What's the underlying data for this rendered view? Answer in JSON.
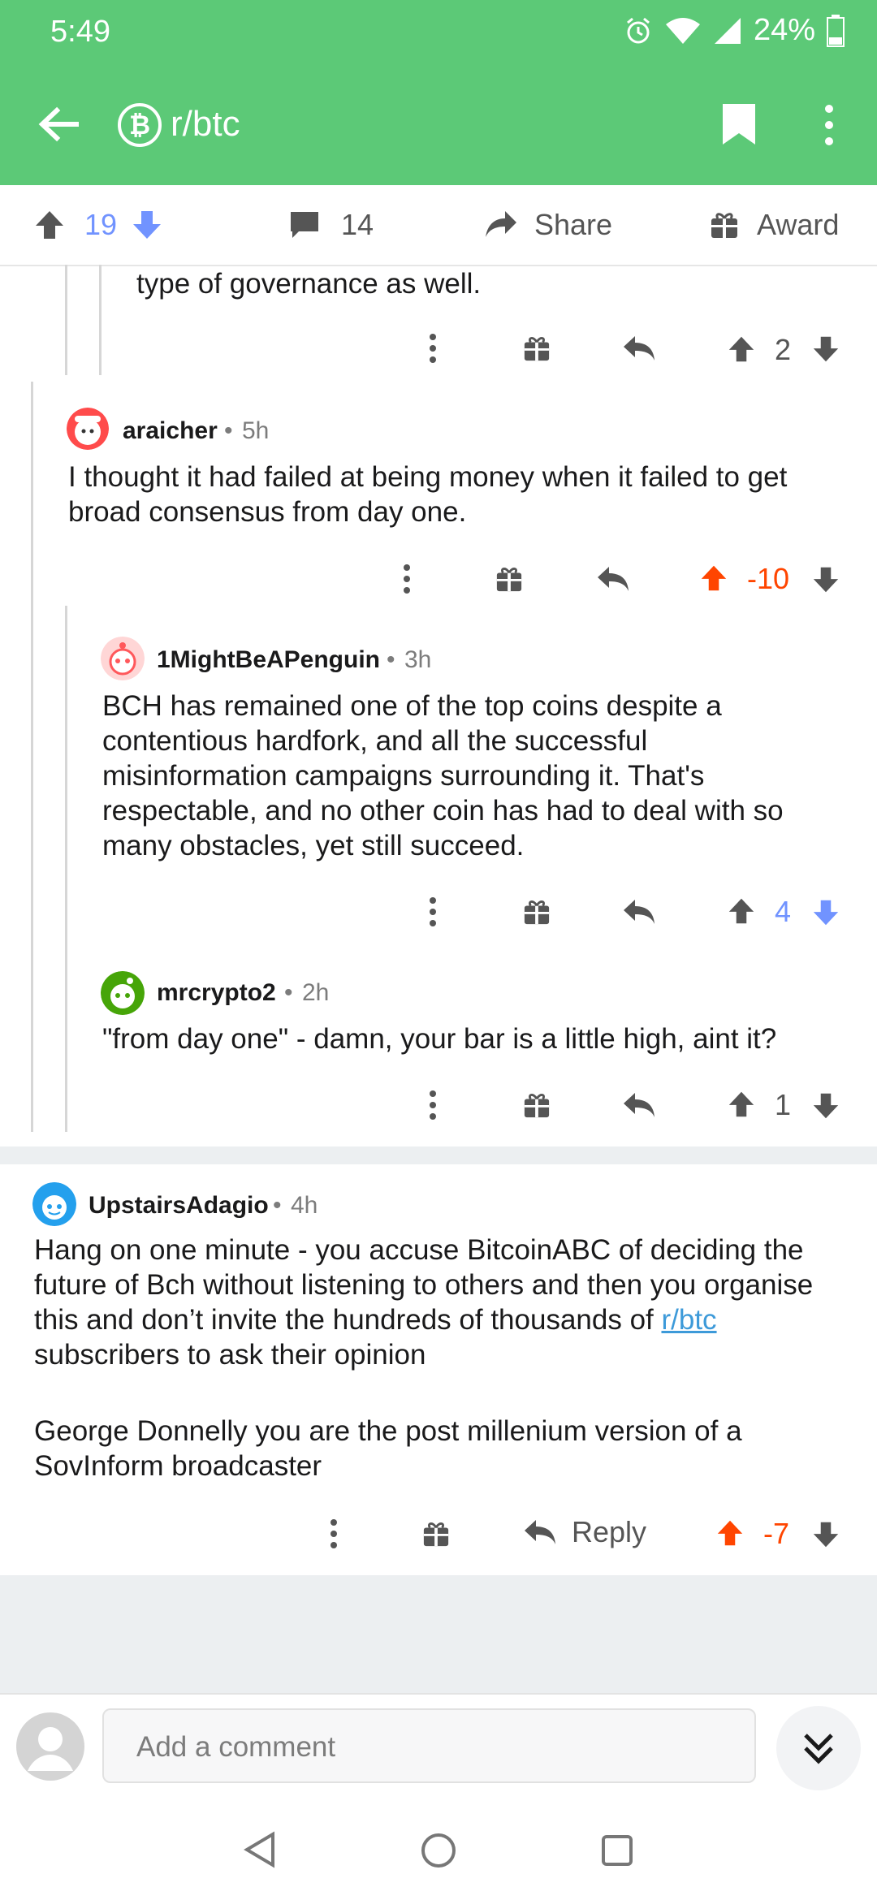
{
  "status": {
    "time": "5:49",
    "battery": "24%"
  },
  "appbar": {
    "title": "r/btc"
  },
  "post_actions": {
    "score": "19",
    "comments": "14",
    "share": "Share",
    "award": "Award"
  },
  "comments": [
    {
      "text": "type of governance as well.",
      "score": "2"
    },
    {
      "author": "araicher",
      "age": "5h",
      "text": "I thought it had failed at being money when it failed to get broad consensus from day one.",
      "score": "-10",
      "vote": "up"
    },
    {
      "author": "1MightBeAPenguin",
      "age": "3h",
      "text": "BCH has remained one of the top coins despite a contentious hardfork, and all the successful misinformation campaigns surrounding it. That's respectable, and no other coin has had to deal with so many obstacles, yet still succeed.",
      "score": "4",
      "vote": "down"
    },
    {
      "author": "mrcrypto2",
      "age": "2h",
      "text": "\"from day one\" - damn, your bar is a little high, aint it?",
      "score": "1"
    },
    {
      "author": "UpstairsAdagio",
      "age": "4h",
      "text_before_link": "Hang on one minute - you accuse BitcoinABC of deciding the future of Bch without listening to others and then you organise this and don’t invite the hundreds of thousands of ",
      "link": "r/btc",
      "text_after_link": " subscribers to ask their opinion",
      "text2": "George Donnelly you are the post millenium version of a SovInform broadcaster",
      "reply": "Reply",
      "score": "-7",
      "vote": "up"
    }
  ],
  "composer": {
    "placeholder": "Add a comment"
  },
  "colors": {
    "brand_green": "#5cc977",
    "upvote": "#ff4500",
    "downvote": "#7193ff"
  }
}
